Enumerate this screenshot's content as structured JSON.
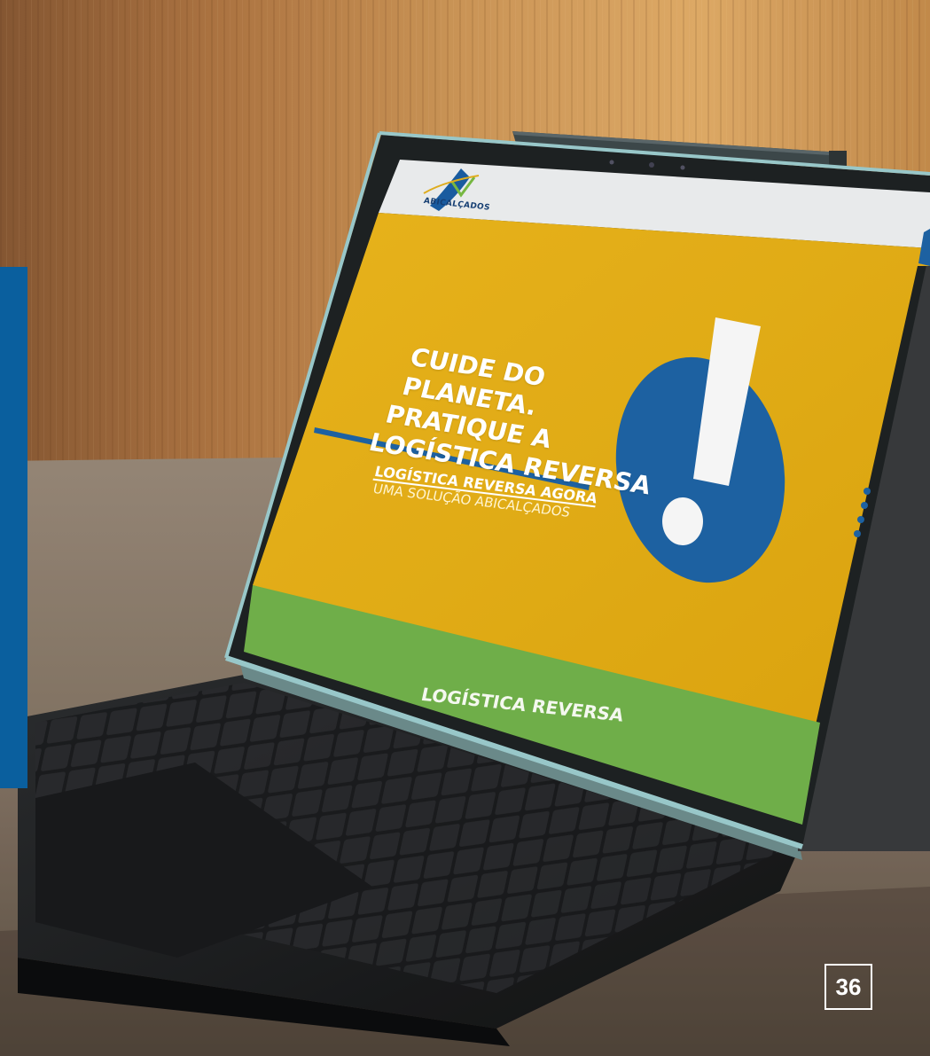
{
  "page": {
    "number": "36"
  },
  "laptop_screen": {
    "logo_text": "ABICALÇADOS",
    "headline": [
      "CUIDE DO PLANETA.",
      "PRATIQUE A",
      "LOGÍSTICA REVERSA"
    ],
    "subheading": "LOGÍSTICA REVERSA AGORA",
    "tagline": "UMA SOLUÇÃO ABICALÇADOS",
    "green_section_label": "LOGÍSTICA REVERSA"
  },
  "colors": {
    "side_bar": "#0a5f9e",
    "screen_yellow": "#eab117",
    "screen_blue": "#1f65a8",
    "screen_green": "#74b64c"
  },
  "icons": [
    "exclamation-mark-icon",
    "vertical-dots-icon",
    "abicalcados-logo"
  ]
}
